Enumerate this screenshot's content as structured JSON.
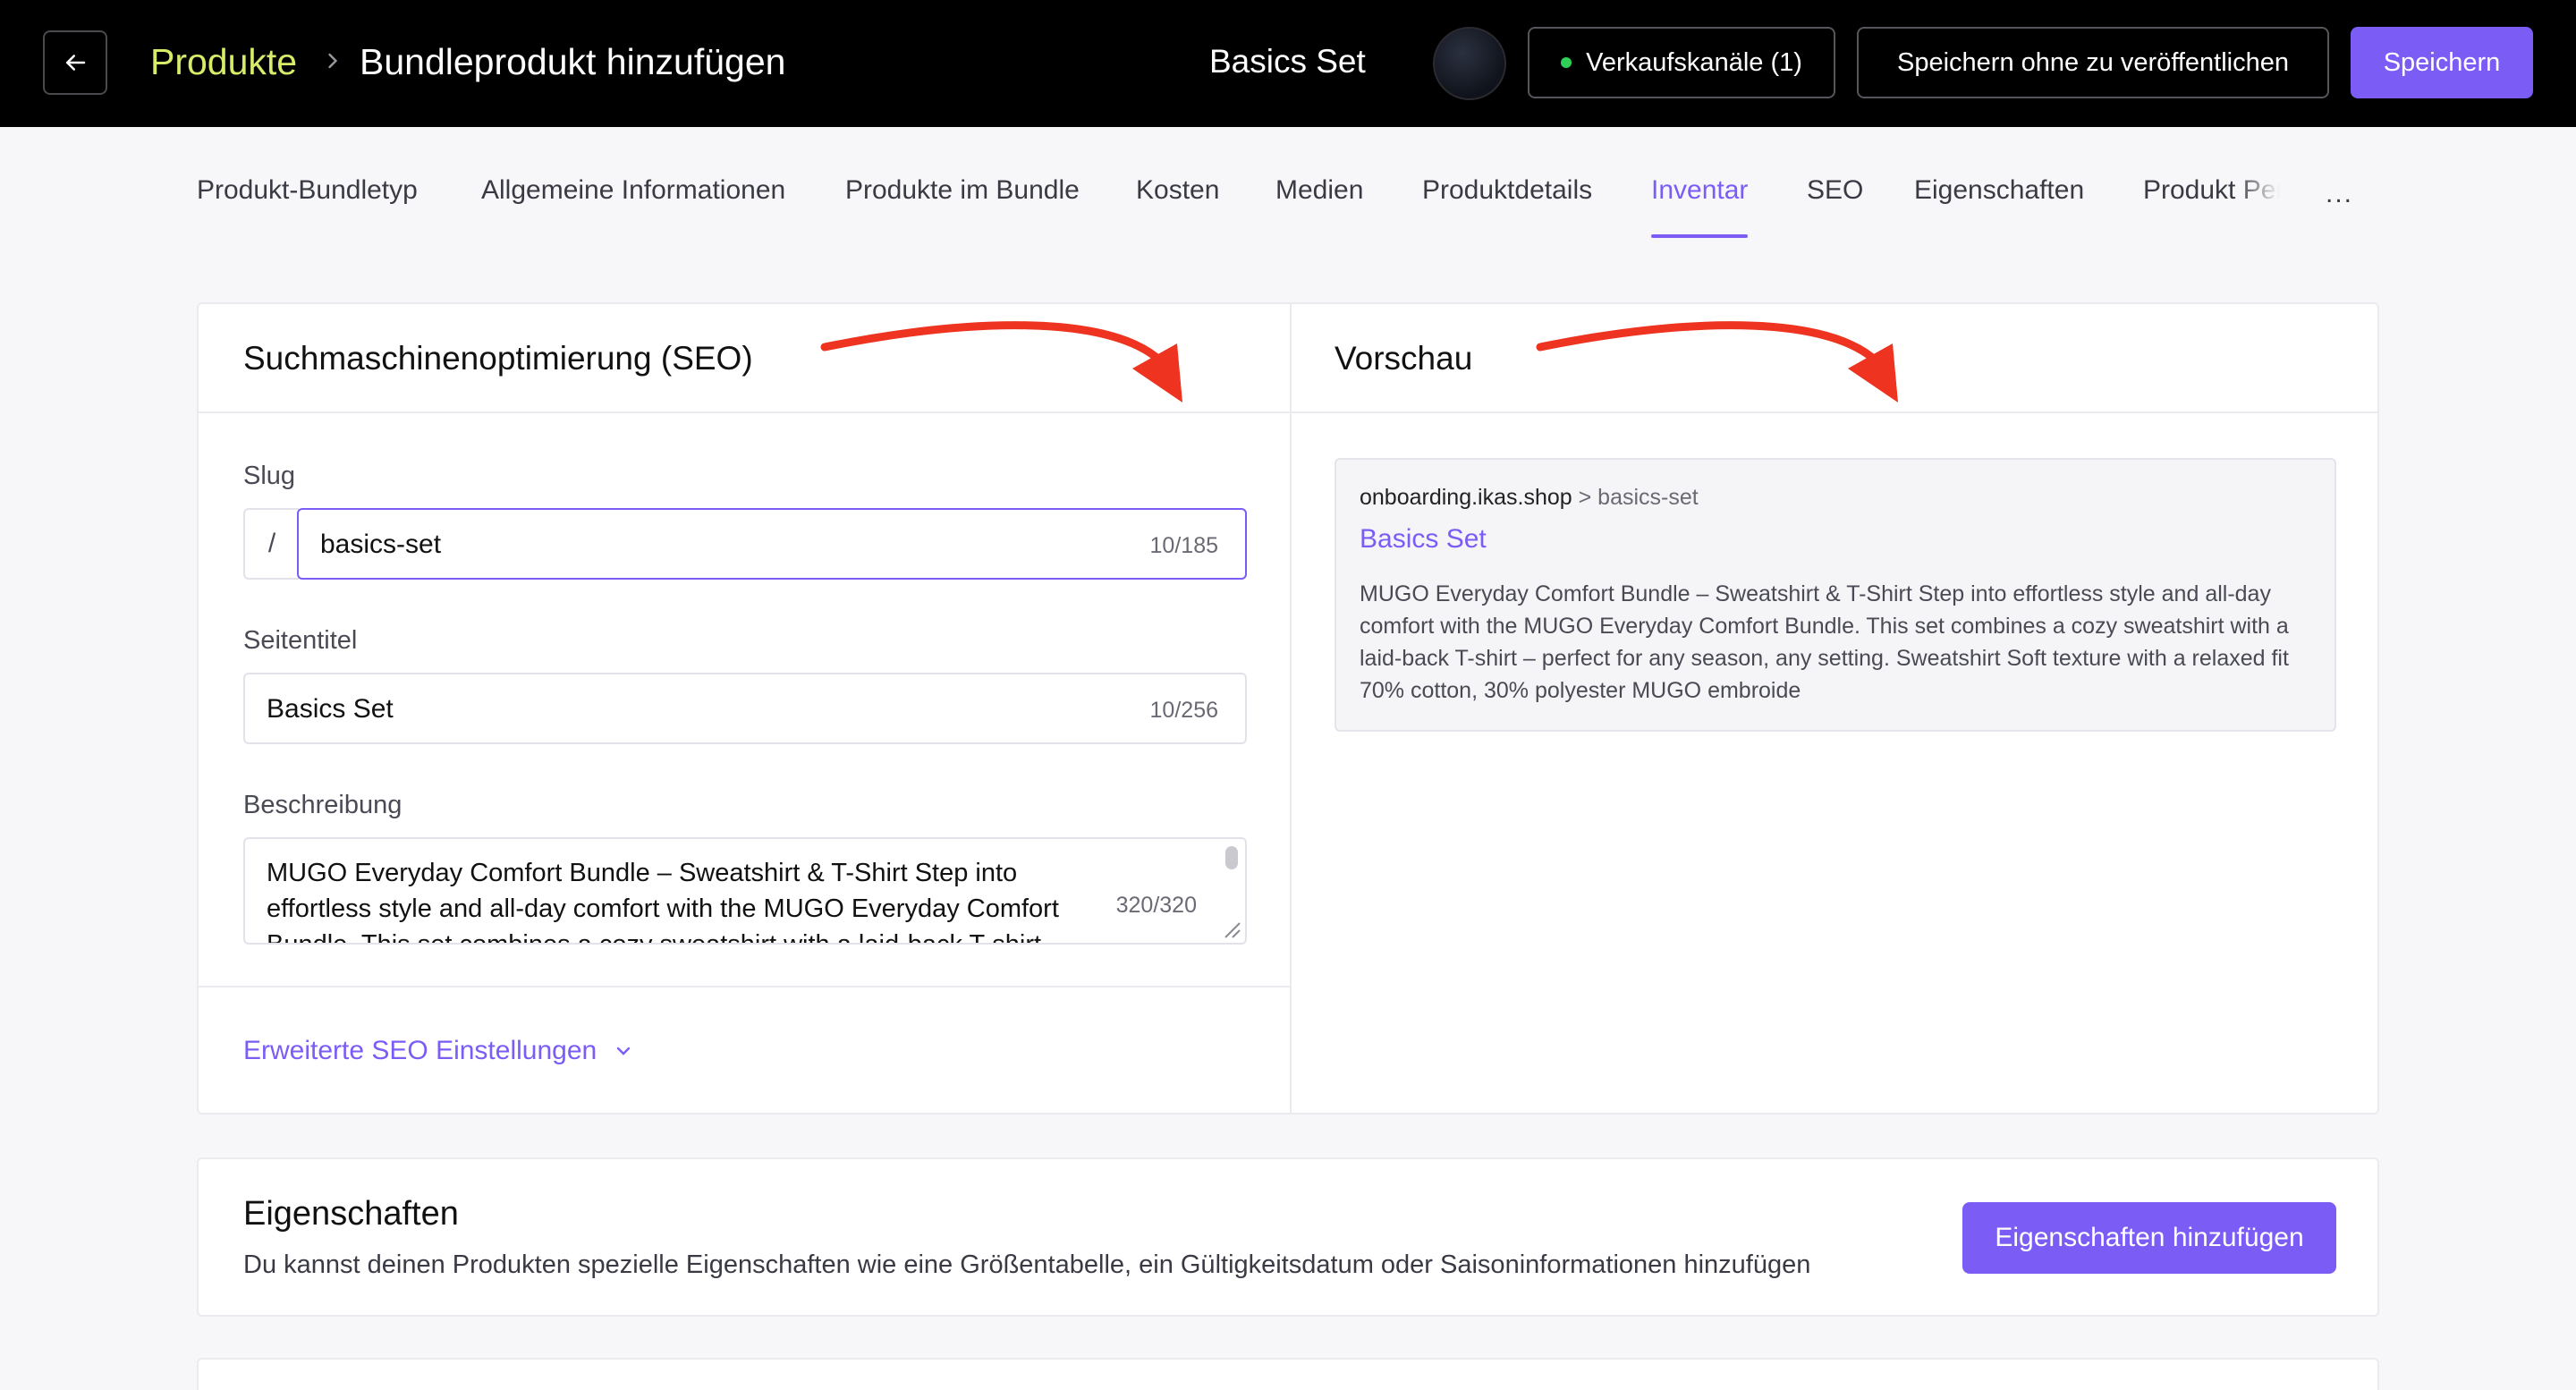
{
  "header": {
    "breadcrumb_root": "Produkte",
    "breadcrumb_current": "Bundleprodukt hinzufügen",
    "product_name": "Basics Set",
    "sales_channels_label": "Verkaufskanäle (1)",
    "save_draft_label": "Speichern ohne zu veröffentlichen",
    "save_label": "Speichern"
  },
  "tabs": [
    {
      "label": "Produkt-Bundletyp"
    },
    {
      "label": "Allgemeine Informationen"
    },
    {
      "label": "Produkte im Bundle"
    },
    {
      "label": "Kosten"
    },
    {
      "label": "Medien"
    },
    {
      "label": "Produktdetails"
    },
    {
      "label": "Inventar",
      "active": true
    },
    {
      "label": "SEO"
    },
    {
      "label": "Eigenschaften"
    },
    {
      "label": "Produkt Pers"
    }
  ],
  "tabs_more": "...",
  "seo": {
    "title": "Suchmaschinenoptimierung (SEO)",
    "slug_label": "Slug",
    "slug_prefix": "/",
    "slug_value": "basics-set",
    "slug_counter": "10/185",
    "page_title_label": "Seitentitel",
    "page_title_value": "Basics Set",
    "page_title_counter": "10/256",
    "description_label": "Beschreibung",
    "description_value": "MUGO Everyday Comfort Bundle – Sweatshirt & T-Shirt Step into effortless style and all-day comfort with the MUGO Everyday Comfort Bundle. This set combines a cozy sweatshirt with a laid-back T-shirt",
    "description_counter": "320/320",
    "advanced_link": "Erweiterte SEO Einstellungen"
  },
  "preview": {
    "title": "Vorschau",
    "domain": "onboarding.ikas.shop",
    "path": " > basics-set",
    "link_title": "Basics Set",
    "description": "MUGO Everyday Comfort Bundle – Sweatshirt & T-Shirt Step into effortless style and all-day comfort with the MUGO Everyday Comfort Bundle. This set combines a cozy sweatshirt with a laid-back T-shirt – perfect for any season, any setting. Sweatshirt Soft texture with a relaxed fit 70% cotton, 30% polyester MUGO embroide"
  },
  "properties": {
    "title": "Eigenschaften",
    "description": "Du kannst deinen Produkten spezielle Eigenschaften wie eine Größentabelle, ein Gültigkeitsdatum oder Saisoninformationen hinzufügen",
    "add_button": "Eigenschaften hinzufügen"
  },
  "colors": {
    "accent": "#7b5cf5",
    "breadcrumb": "#d9ec6a",
    "status_green": "#30d158",
    "annotation_arrow": "#ee3320"
  },
  "icons": [
    "arrow-left-icon",
    "chevron-right-icon",
    "chevron-down-icon",
    "status-dot-icon",
    "resize-handle-icon"
  ]
}
